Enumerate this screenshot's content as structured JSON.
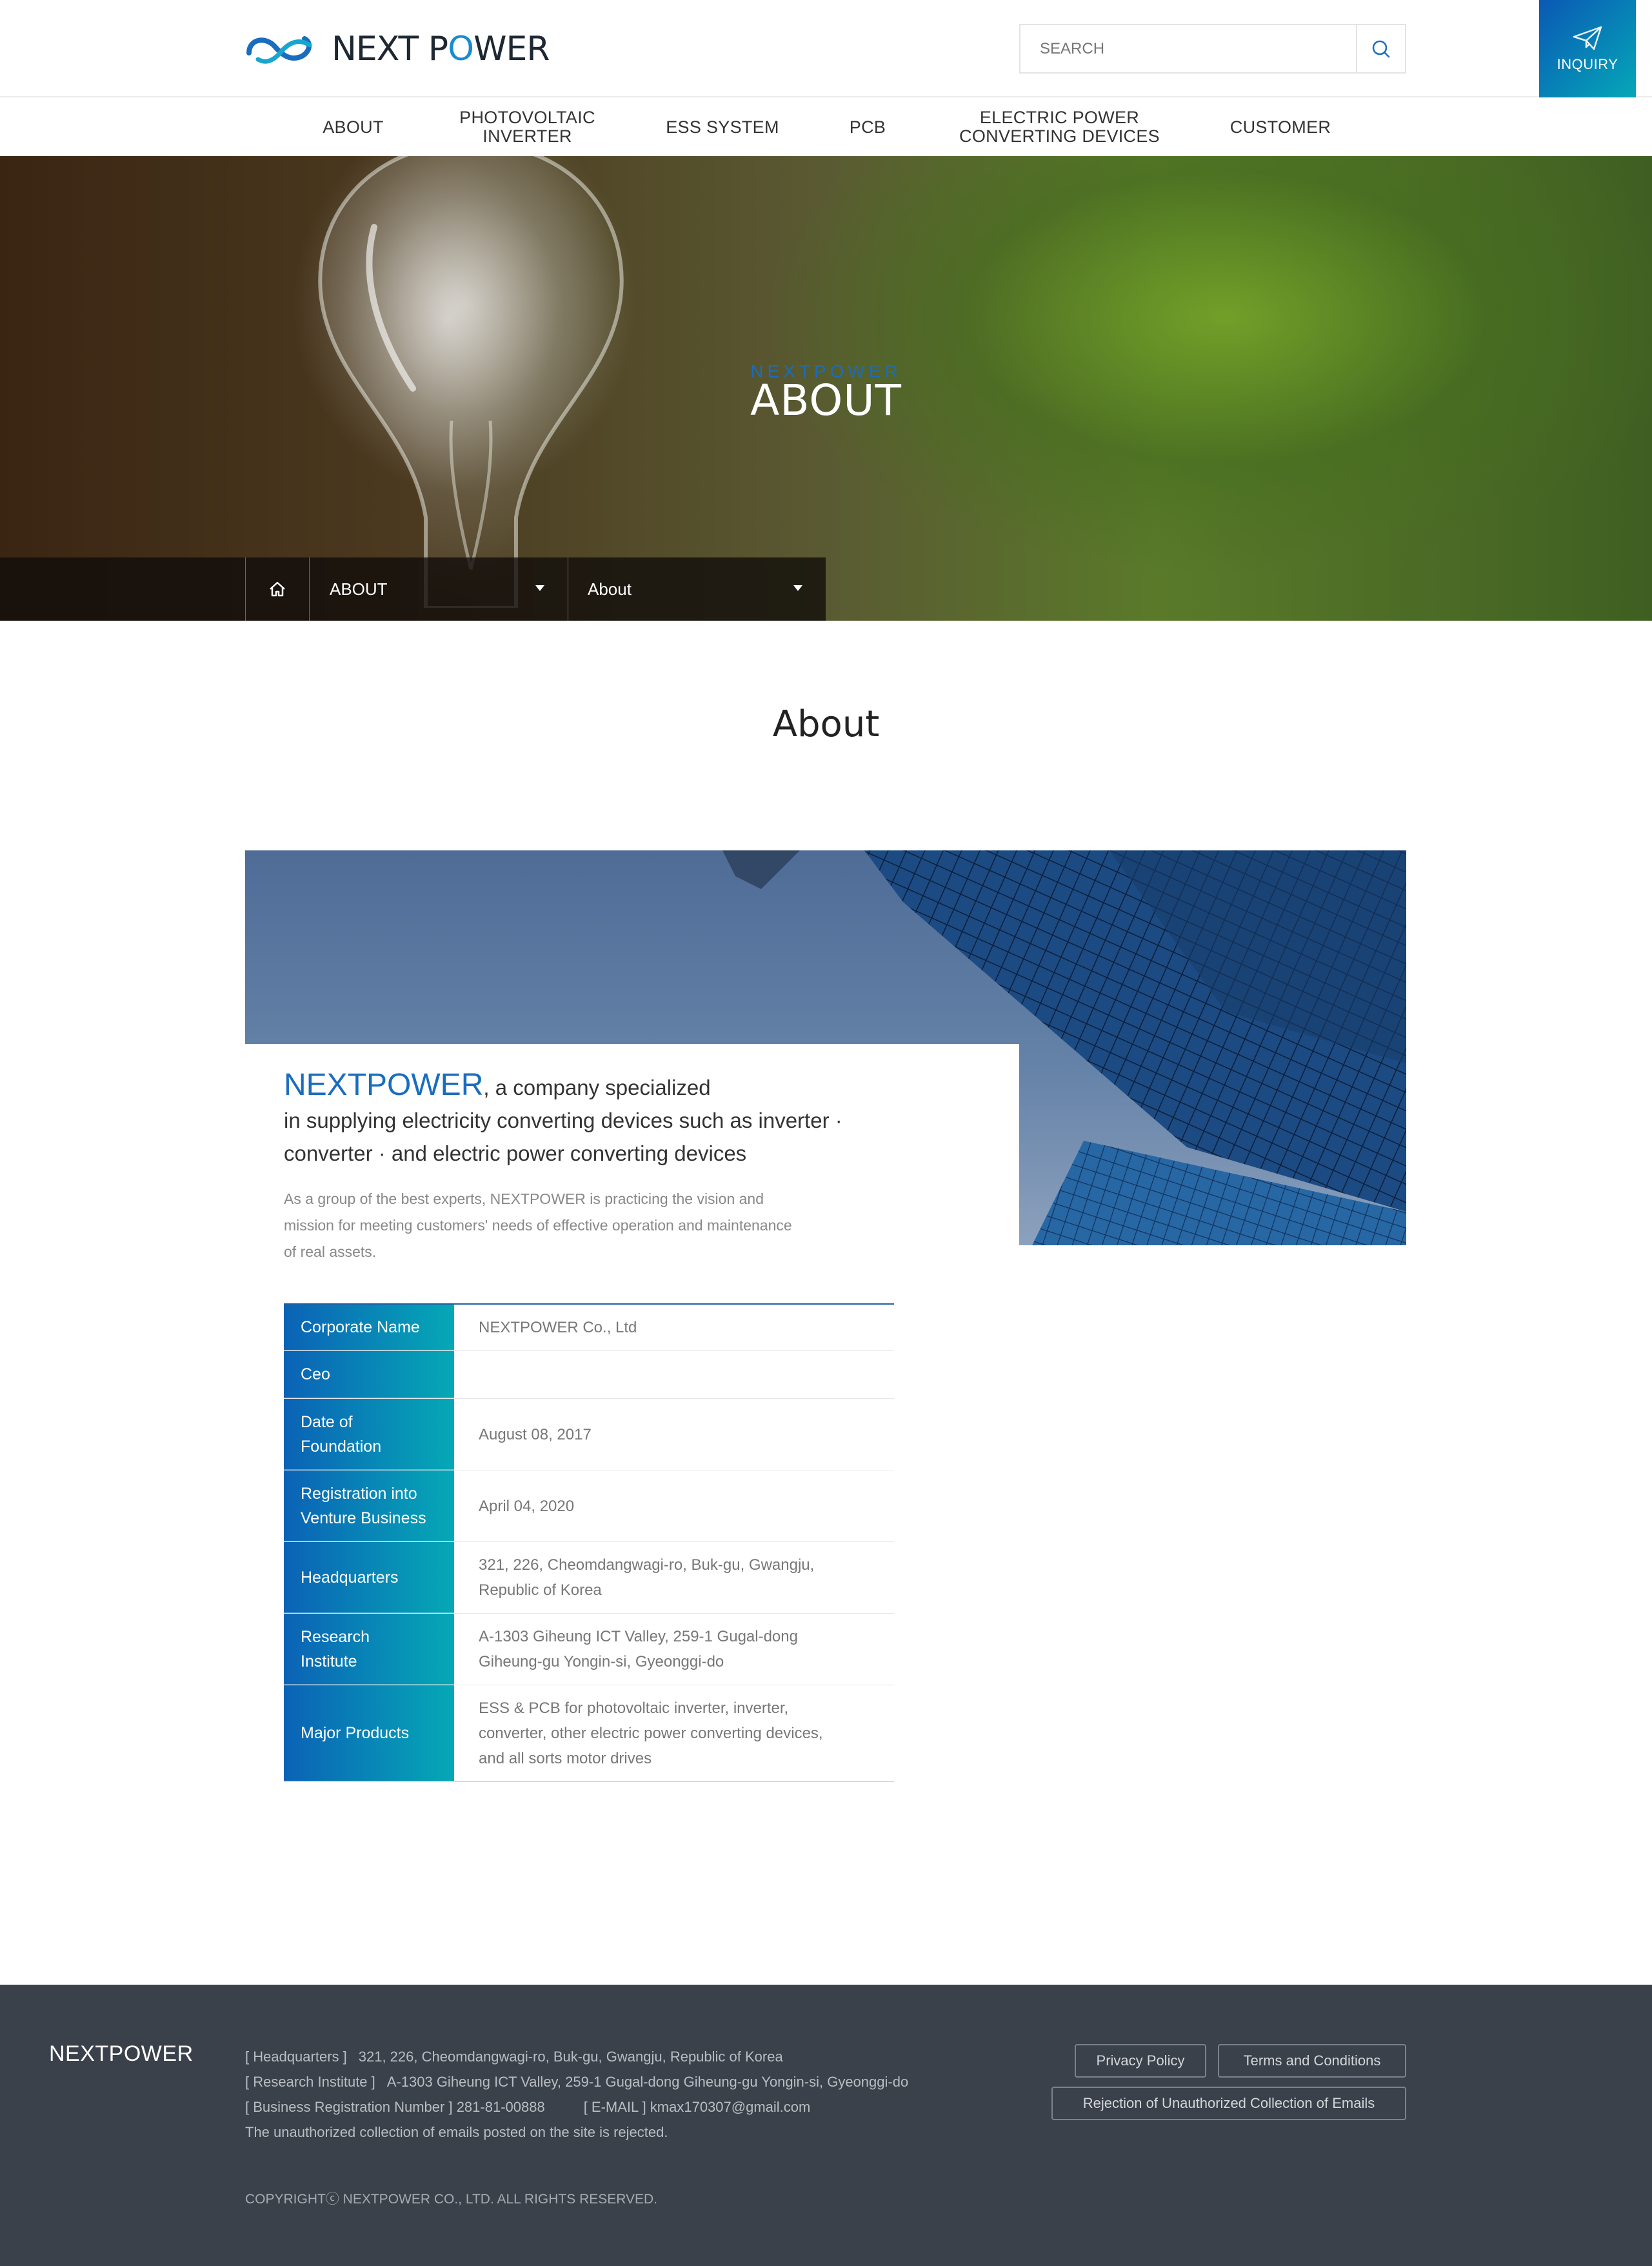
{
  "header": {
    "logo_text_prefix": "NEXT P",
    "logo_text_o": "O",
    "logo_text_suffix": "WER",
    "search_placeholder": "SEARCH",
    "inquiry_label": "INQUIRY"
  },
  "nav": [
    {
      "line1": "ABOUT",
      "line2": ""
    },
    {
      "line1": "PHOTOVOLTAIC",
      "line2": "INVERTER"
    },
    {
      "line1": "ESS SYSTEM",
      "line2": ""
    },
    {
      "line1": "PCB",
      "line2": ""
    },
    {
      "line1": "ELECTRIC POWER",
      "line2": "CONVERTING DEVICES"
    },
    {
      "line1": "CUSTOMER",
      "line2": ""
    }
  ],
  "hero": {
    "subtitle": "NEXTPOWER",
    "title": "ABOUT",
    "breadcrumb": [
      "ABOUT",
      "About"
    ]
  },
  "content": {
    "page_title": "About",
    "lead_brand": "NEXTPOWER",
    "lead_rest_1": ", a company specialized",
    "lead_line_2": "in supplying electricity converting devices such as inverter ·",
    "lead_line_3": "converter · and electric power converting devices",
    "desc_line_1": "As a group of the best experts, NEXTPOWER is practicing the vision and",
    "desc_line_2": "mission for meeting customers' needs of effective operation and maintenance",
    "desc_line_3": "of real assets."
  },
  "info_table": [
    {
      "label_1": "Corporate Name",
      "label_2": "",
      "value_1": "NEXTPOWER Co., Ltd",
      "value_2": "",
      "value_3": ""
    },
    {
      "label_1": "Ceo",
      "label_2": "",
      "value_1": "",
      "value_2": "",
      "value_3": ""
    },
    {
      "label_1": "Date of",
      "label_2": "Foundation",
      "value_1": "August 08, 2017",
      "value_2": "",
      "value_3": ""
    },
    {
      "label_1": "Registration into",
      "label_2": "Venture Business",
      "value_1": "April 04, 2020",
      "value_2": "",
      "value_3": ""
    },
    {
      "label_1": "Headquarters",
      "label_2": "",
      "value_1": "321, 226, Cheomdangwagi-ro, Buk-gu, Gwangju,",
      "value_2": "Republic of Korea",
      "value_3": ""
    },
    {
      "label_1": "Research",
      "label_2": "Institute",
      "value_1": "A-1303 Giheung ICT Valley, 259-1 Gugal-dong",
      "value_2": "Giheung-gu Yongin-si, Gyeonggi-do",
      "value_3": ""
    },
    {
      "label_1": "Major Products",
      "label_2": "",
      "value_1": "ESS & PCB for photovoltaic inverter, inverter,",
      "value_2": "converter, other electric power converting devices,",
      "value_3": "and all sorts motor drives"
    }
  ],
  "footer": {
    "logo": "NEXTPOWER",
    "hq_label": "[ Headquarters ]",
    "hq_value": "321, 226, Cheomdangwagi-ro, Buk-gu, Gwangju, Republic of Korea",
    "ri_label": "[ Research Institute ]",
    "ri_value": "A-1303 Giheung ICT Valley, 259-1 Gugal-dong Giheung-gu Yongin-si, Gyeonggi-do",
    "brn": "[ Business Registration Number ] 281-81-00888",
    "email": "[ E-MAIL ] kmax170307@gmail.com",
    "notice": "The unauthorized collection of emails posted on the site is rejected.",
    "copyright": "COPYRIGHTⓒ NEXTPOWER CO., LTD. ALL RIGHTS RESERVED.",
    "privacy": "Privacy Policy",
    "terms": "Terms and Conditions",
    "rejection": "Rejection of Unauthorized Collection of Emails"
  },
  "colors": {
    "brand_blue": "#1a6dbe",
    "gradient_start": "#0b62b6",
    "gradient_end": "#05a8b6",
    "footer_bg": "#3b414a"
  }
}
